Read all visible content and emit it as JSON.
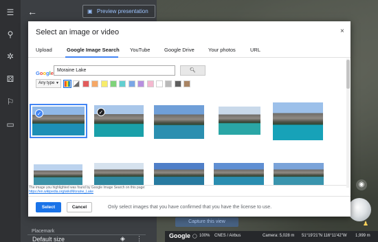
{
  "topbar": {
    "preview_label": "Preview presentation"
  },
  "panel": {
    "placemark_label": "Placemark",
    "default_size_label": "Default size"
  },
  "modal": {
    "title": "Select an image or video",
    "close_label": "×",
    "tabs": [
      {
        "label": "Upload"
      },
      {
        "label": "Google Image Search",
        "active": true
      },
      {
        "label": "YouTube"
      },
      {
        "label": "Google Drive"
      },
      {
        "label": "Your photos"
      },
      {
        "label": "URL"
      }
    ],
    "search": {
      "brand": "Google",
      "value": "Moraine Lake",
      "button_icon": "search-icon"
    },
    "filter": {
      "type_label": "Any type",
      "colors": [
        "#ffffff",
        "#6b6b6b",
        "#e25c5c",
        "#f5a866",
        "#f7ec6b",
        "#7fd37a",
        "#62cfd0",
        "#7aa7e6",
        "#b78fe0",
        "#f4b8cf",
        "#ffffff",
        "#b9b9b9",
        "#5e5e5e",
        "#a98463"
      ]
    },
    "results": [
      {
        "selected": "blue"
      },
      {
        "selected": "dark"
      },
      {},
      {},
      {},
      {},
      {},
      {},
      {},
      {}
    ],
    "footnote": {
      "line1": "The image you highlighted was found by Google Image Search on this page:",
      "link": "https://en.wikipedia.org/wiki/Moraine_Lake"
    },
    "actions": {
      "select_label": "Select",
      "cancel_label": "Cancel",
      "license_note": "Only select images that you have confirmed that you have the license to use."
    }
  },
  "map": {
    "capture_label": "Capture this view",
    "brand": "Google",
    "zoom": "100%",
    "attribution": "CNES / Airbus",
    "camera": "Camera: 5,028 m",
    "coords": "51°19'21\"N 116°11'42\"W",
    "elevation": "1,999 m"
  },
  "colors": {
    "accent": "#1a73e8",
    "tab_underline": "#4285f4"
  }
}
